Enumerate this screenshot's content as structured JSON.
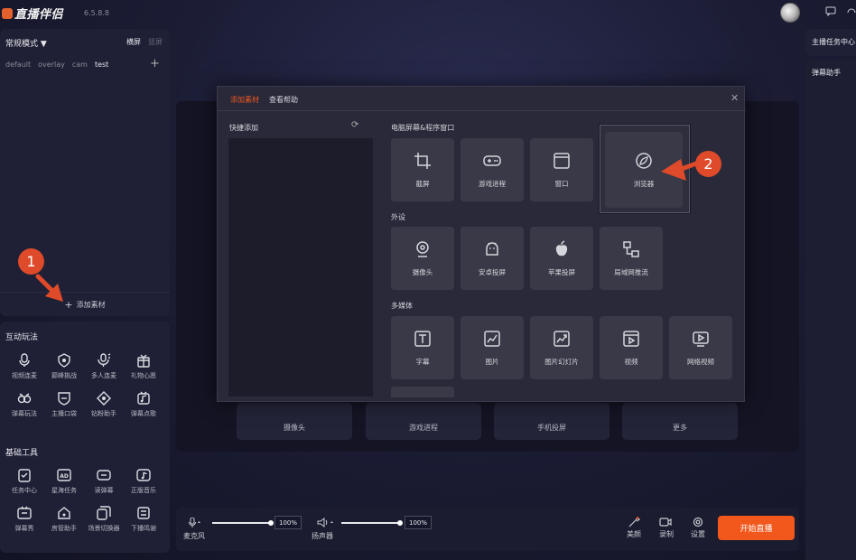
{
  "app": {
    "name": "直播伴侣",
    "version": "6.5.8.8"
  },
  "scene_panel": {
    "mode": "常规模式 ▼",
    "orientation_horizontal": "横屏",
    "orientation_vertical": "竖屏",
    "scenes": [
      "default",
      "overlay",
      "cam",
      "test"
    ],
    "add_source": "添加素材"
  },
  "interactive": {
    "title": "互动玩法",
    "items": [
      "视频连麦",
      "巅峰挑战",
      "多人连麦",
      "礼物心愿",
      "弹幕玩法",
      "主播口袋",
      "钻粉助手",
      "弹幕点歌"
    ]
  },
  "basic_tools": {
    "title": "基础工具",
    "items": [
      "任务中心",
      "星海任务",
      "读弹幕",
      "正版音乐",
      "弹幕秀",
      "房管助手",
      "场景切换器",
      "下播鸣谢"
    ]
  },
  "right_panel": {
    "task_center": "主播任务中心",
    "danmu_helper": "弹幕助手"
  },
  "preview": {
    "quick_cards": [
      "摄像头",
      "游戏进程",
      "手机投屏",
      "更多"
    ]
  },
  "bottom": {
    "mic_label": "麦克风",
    "mic_volume": "100%",
    "mic_level": 1.0,
    "speaker_label": "扬声器",
    "speaker_volume": "100%",
    "speaker_level": 1.0,
    "beauty": "美颜",
    "record": "录制",
    "settings": "设置",
    "start_button": "开始直播"
  },
  "dialog": {
    "tab_add": "添加素材",
    "tab_help": "查看帮助",
    "quick_add": "快捷添加",
    "group1": {
      "title": "电脑屏幕&程序窗口",
      "items": [
        "截屏",
        "游戏进程",
        "窗口",
        "浏览器"
      ]
    },
    "group2": {
      "title": "外设",
      "items": [
        "摄像头",
        "安卓投屏",
        "苹果投屏",
        "局域网推流"
      ]
    },
    "group3": {
      "title": "多媒体",
      "items": [
        "字幕",
        "图片",
        "图片幻灯片",
        "视频",
        "网络视频"
      ]
    }
  },
  "annotations": {
    "badge1": "1",
    "badge2": "2"
  },
  "colors": {
    "accent": "#f2571c",
    "badge": "#de4a2a",
    "panel": "#1f2035",
    "dialog": "#29293a"
  }
}
